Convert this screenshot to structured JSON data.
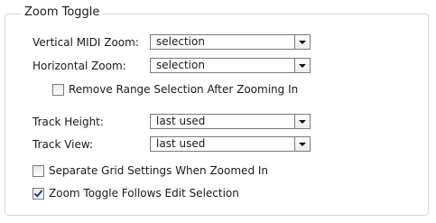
{
  "group": {
    "title": "Zoom Toggle"
  },
  "fields": [
    {
      "label": "Vertical MIDI Zoom:",
      "value": "selection"
    },
    {
      "label": "Horizontal Zoom:",
      "value": "selection"
    },
    {
      "label": "Track Height:",
      "value": "last used"
    },
    {
      "label": "Track View:",
      "value": "last used"
    }
  ],
  "checkboxes": [
    {
      "label": "Remove Range Selection After Zooming In",
      "checked": false
    },
    {
      "label": "Separate Grid Settings When Zoomed In",
      "checked": false
    },
    {
      "label": "Zoom Toggle Follows Edit Selection",
      "checked": true
    }
  ]
}
